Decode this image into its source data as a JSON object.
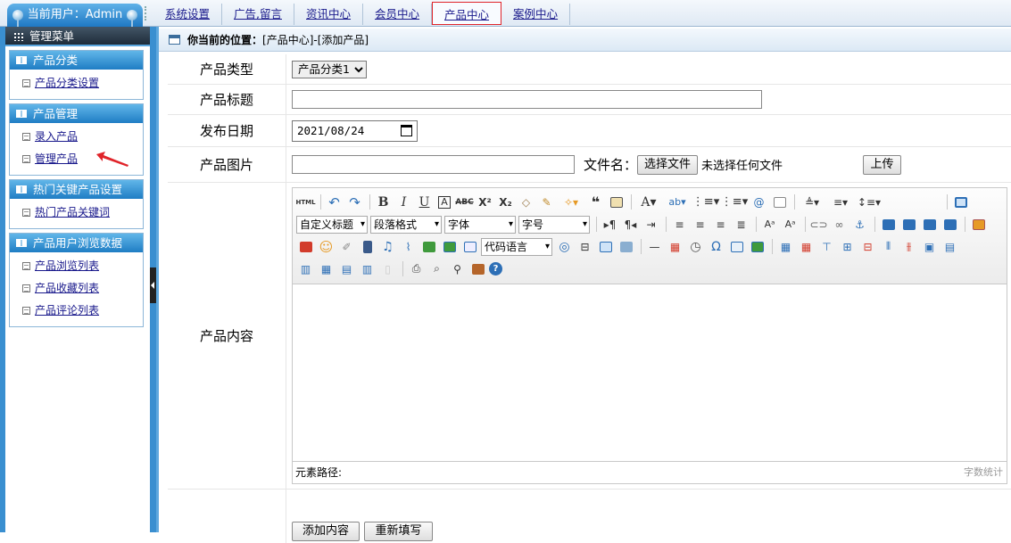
{
  "top": {
    "current_user": "当前用户：Admin",
    "nav": [
      {
        "label": "系统设置"
      },
      {
        "label": "广告,留言"
      },
      {
        "label": "资讯中心"
      },
      {
        "label": "会员中心"
      },
      {
        "label": "产品中心",
        "active": true
      },
      {
        "label": "案例中心"
      }
    ]
  },
  "sidebar": {
    "header": "管理菜单",
    "groups": [
      {
        "title": "产品分类",
        "items": [
          {
            "label": "产品分类设置"
          }
        ]
      },
      {
        "title": "产品管理",
        "items": [
          {
            "label": "录入产品"
          },
          {
            "label": "管理产品"
          }
        ]
      },
      {
        "title": "热门关键产品设置",
        "items": [
          {
            "label": "热门产品关键词"
          }
        ]
      },
      {
        "title": "产品用户浏览数据",
        "items": [
          {
            "label": "产品浏览列表"
          },
          {
            "label": "产品收藏列表"
          },
          {
            "label": "产品评论列表"
          }
        ]
      }
    ]
  },
  "breadcrumb": {
    "prefix": "你当前的位置：",
    "path": "[产品中心]-[添加产品]"
  },
  "form": {
    "type_label": "产品类型",
    "type_value": "产品分类1",
    "title_label": "产品标题",
    "title_value": "",
    "date_label": "发布日期",
    "date_value": "2021/08/24",
    "image_label": "产品图片",
    "image_value": "",
    "filename_label": "文件名：",
    "choose_file": "选择文件",
    "no_file": "未选择任何文件",
    "upload": "上传",
    "content_label": "产品内容",
    "submit": "添加内容",
    "reset": "重新填写"
  },
  "editor": {
    "selects": {
      "custom_title": "自定义标题",
      "paragraph": "段落格式",
      "font": "字体",
      "size": "字号",
      "code_lang": "代码语言"
    },
    "status_path": "元素路径:",
    "word_count": "字数统计",
    "colors": {
      "icon_blue": "#2d6fb6",
      "icon_red": "#d23b2b",
      "icon_green": "#3f9a3c",
      "icon_orange": "#e69a26"
    }
  }
}
